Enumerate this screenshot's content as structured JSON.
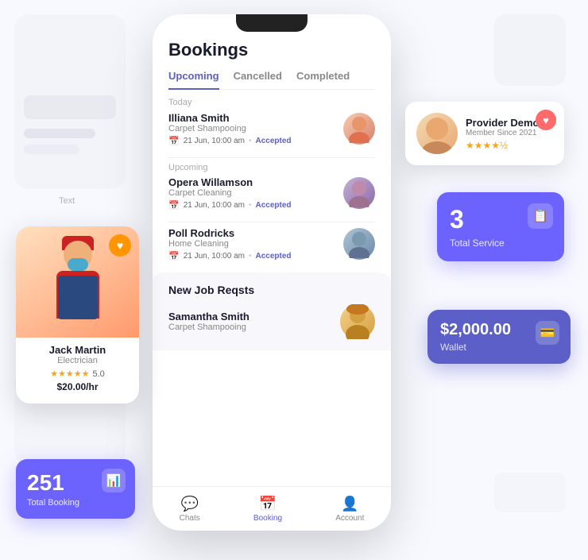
{
  "app": {
    "title": "Bookings",
    "tabs": [
      {
        "label": "Upcoming",
        "active": true
      },
      {
        "label": "Cancelled",
        "active": false
      },
      {
        "label": "Completed",
        "active": false
      }
    ]
  },
  "sections": {
    "today_label": "Today",
    "upcoming_label": "Upcoming"
  },
  "bookings": [
    {
      "name": "Illiana Smith",
      "service": "Carpet Shampooing",
      "date": "21 Jun, 10:00 am",
      "status": "Accepted",
      "section": "today"
    },
    {
      "name": "Opera Willamson",
      "service": "Carpet Cleaning",
      "date": "21 Jun, 10:00 am",
      "status": "Accepted",
      "section": "upcoming"
    },
    {
      "name": "Poll Rodricks",
      "service": "Home Cleaning",
      "date": "21 Jun, 10:00 am",
      "status": "Accepted",
      "section": "upcoming"
    }
  ],
  "new_jobs": {
    "title": "New Job Reqsts",
    "items": [
      {
        "name": "Samantha Smith",
        "service": "Carpet Shampooing"
      }
    ]
  },
  "bottom_nav": [
    {
      "label": "Chats",
      "icon": "💬",
      "active": false
    },
    {
      "label": "Booking",
      "icon": "📅",
      "active": true
    },
    {
      "label": "Account",
      "icon": "👤",
      "active": false
    }
  ],
  "provider_card": {
    "name": "Provider Demo",
    "since": "Member Since 2021",
    "rating": "★★★★½",
    "heart": "♥"
  },
  "total_service_card": {
    "number": "3",
    "label": "Total Service",
    "icon": "📋"
  },
  "wallet_card": {
    "amount": "$2,000.00",
    "label": "Wallet",
    "icon": "💳"
  },
  "worker_card": {
    "name": "Jack Martin",
    "trade": "Electrician",
    "stars": "★★★★★",
    "score": "5.0",
    "rate": "$20.00/hr",
    "heart": "♥"
  },
  "total_booking_card": {
    "number": "251",
    "label": "Total Booking",
    "icon": "📊"
  },
  "bg": {
    "input_placeholder": "Text"
  }
}
